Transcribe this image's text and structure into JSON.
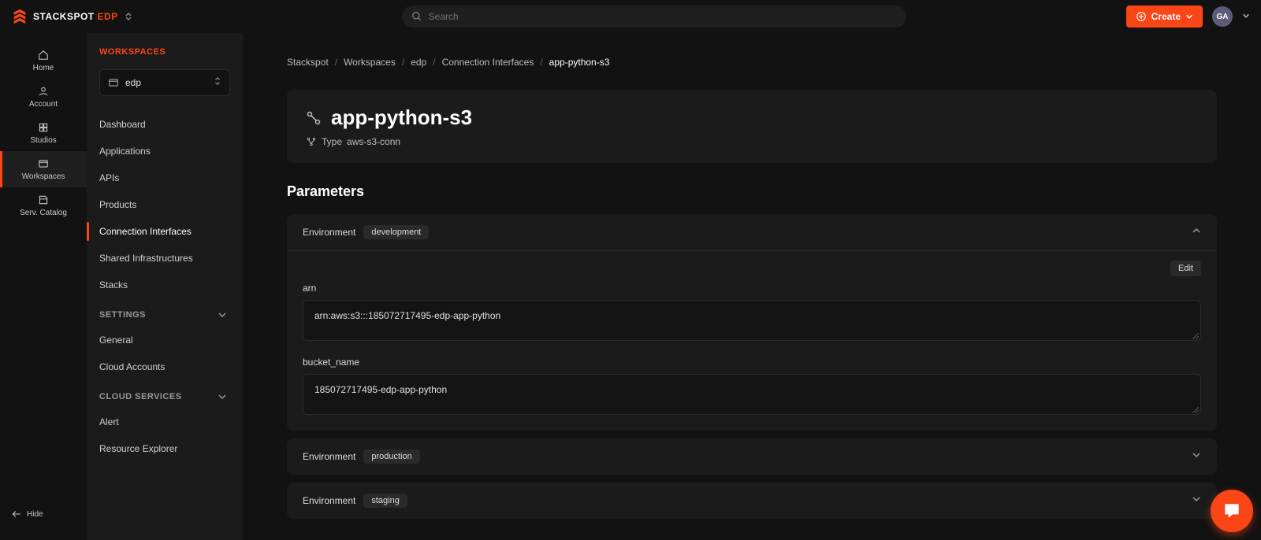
{
  "brand": {
    "name": "STACKSPOT",
    "suffix": "EDP"
  },
  "header": {
    "search_placeholder": "Search",
    "create_label": "Create",
    "avatar_initials": "GA"
  },
  "rail": {
    "items": [
      {
        "label": "Home"
      },
      {
        "label": "Account"
      },
      {
        "label": "Studios"
      },
      {
        "label": "Workspaces"
      },
      {
        "label": "Serv. Catalog"
      }
    ],
    "hide_label": "Hide"
  },
  "sidebar": {
    "heading": "WORKSPACES",
    "workspace_selected": "edp",
    "main_items": [
      {
        "label": "Dashboard"
      },
      {
        "label": "Applications"
      },
      {
        "label": "APIs"
      },
      {
        "label": "Products"
      },
      {
        "label": "Connection Interfaces"
      },
      {
        "label": "Shared Infrastructures"
      },
      {
        "label": "Stacks"
      }
    ],
    "settings_heading": "SETTINGS",
    "settings_items": [
      {
        "label": "General"
      },
      {
        "label": "Cloud Accounts"
      }
    ],
    "cloud_heading": "CLOUD SERVICES",
    "cloud_items": [
      {
        "label": "Alert"
      },
      {
        "label": "Resource Explorer"
      }
    ]
  },
  "breadcrumbs": [
    "Stackspot",
    "Workspaces",
    "edp",
    "Connection Interfaces",
    "app-python-s3"
  ],
  "page": {
    "title": "app-python-s3",
    "type_prefix": "Type",
    "type_value": "aws-s3-conn"
  },
  "parameters": {
    "heading": "Parameters",
    "environment_label": "Environment",
    "edit_label": "Edit",
    "envs": [
      {
        "name": "development",
        "expanded": true,
        "fields": [
          {
            "label": "arn",
            "value": "arn:aws:s3:::185072717495-edp-app-python"
          },
          {
            "label": "bucket_name",
            "value": "185072717495-edp-app-python"
          }
        ]
      },
      {
        "name": "production",
        "expanded": false
      },
      {
        "name": "staging",
        "expanded": false
      }
    ]
  }
}
